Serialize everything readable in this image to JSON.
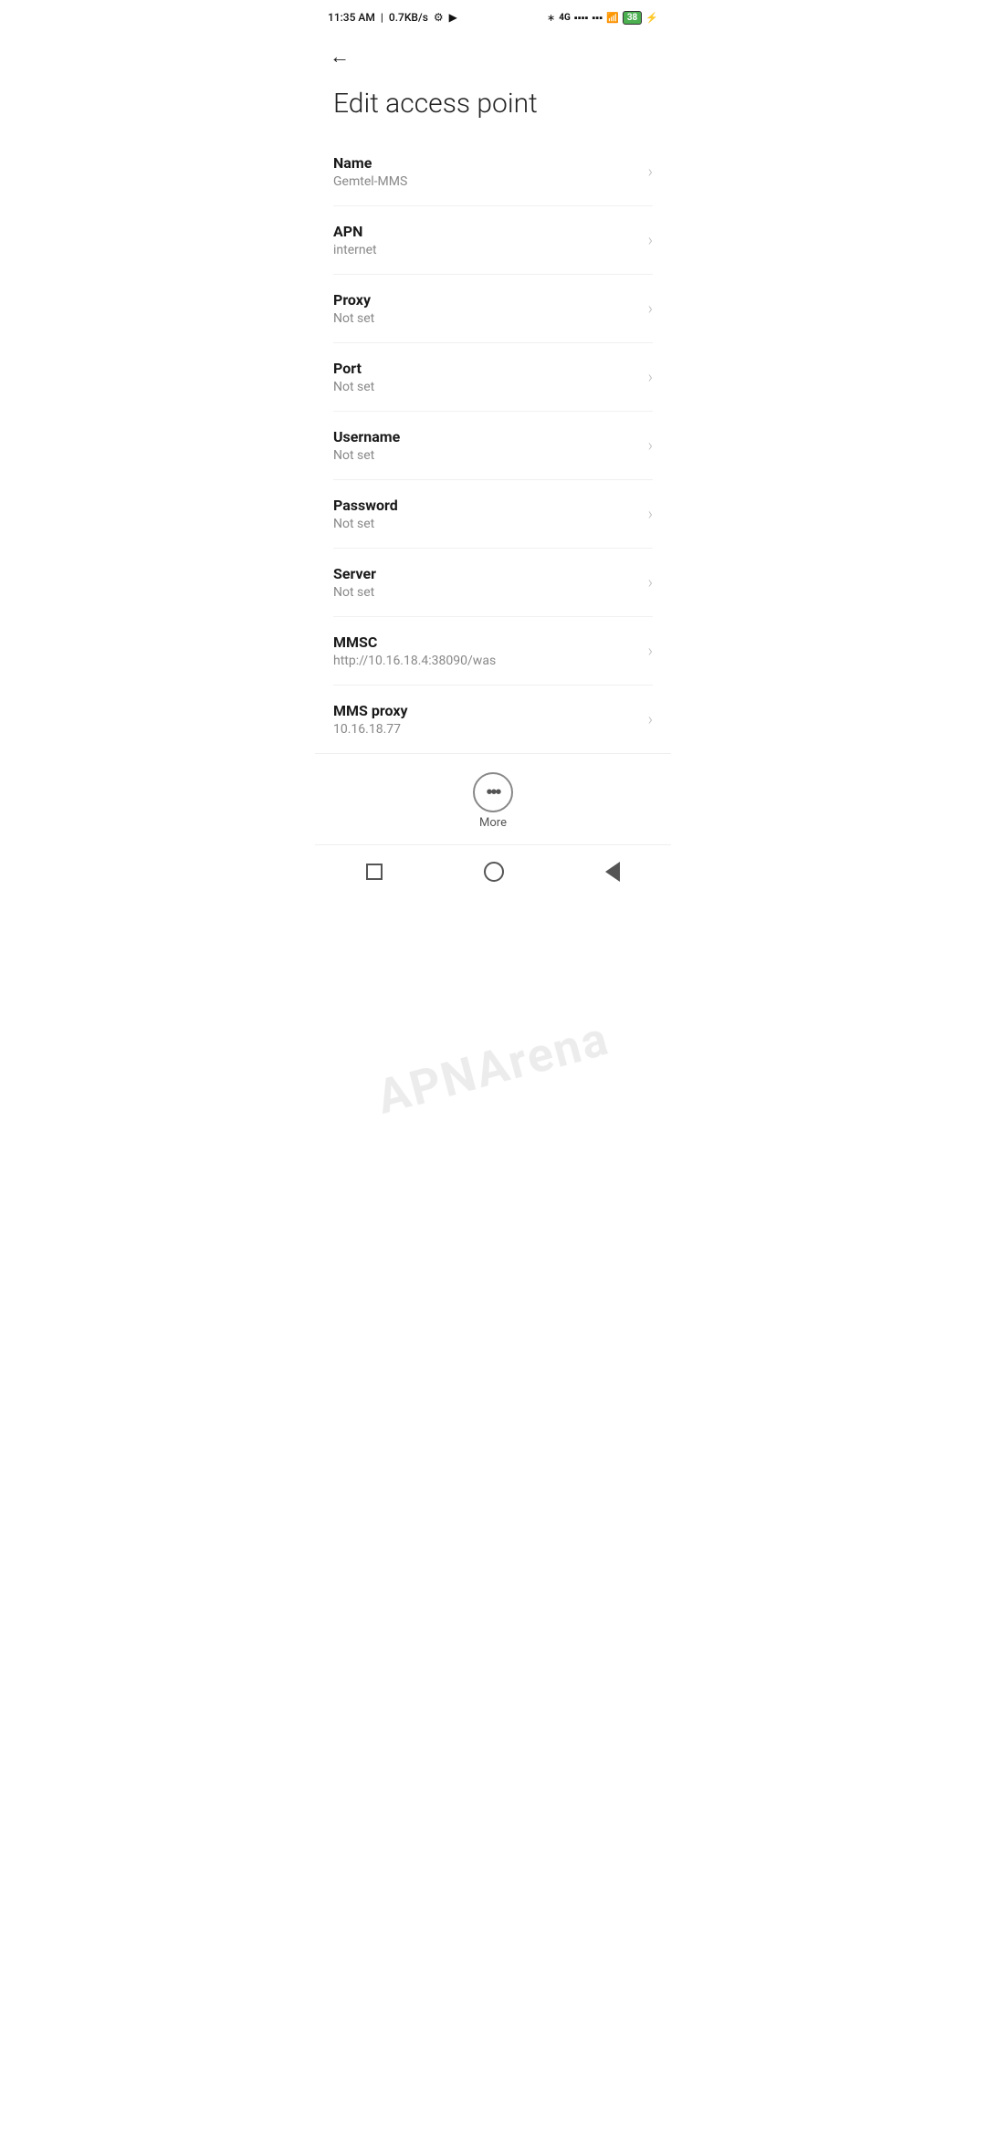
{
  "statusBar": {
    "time": "11:35 AM",
    "speed": "0.7KB/s",
    "battery": "38"
  },
  "toolbar": {
    "backLabel": "←"
  },
  "page": {
    "title": "Edit access point"
  },
  "fields": [
    {
      "label": "Name",
      "value": "Gemtel-MMS"
    },
    {
      "label": "APN",
      "value": "internet"
    },
    {
      "label": "Proxy",
      "value": "Not set"
    },
    {
      "label": "Port",
      "value": "Not set"
    },
    {
      "label": "Username",
      "value": "Not set"
    },
    {
      "label": "Password",
      "value": "Not set"
    },
    {
      "label": "Server",
      "value": "Not set"
    },
    {
      "label": "MMSC",
      "value": "http://10.16.18.4:38090/was"
    },
    {
      "label": "MMS proxy",
      "value": "10.16.18.77"
    }
  ],
  "more": {
    "label": "More"
  },
  "watermark": "APNArena"
}
